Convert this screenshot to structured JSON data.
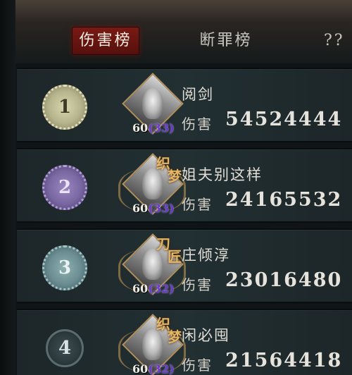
{
  "tabs": [
    {
      "label": "伤害榜",
      "active": true
    },
    {
      "label": "断罪榜",
      "active": false
    },
    {
      "label": "??",
      "active": false
    }
  ],
  "colors": {
    "active_tab": "#6b1612",
    "row_bg": "#223033",
    "level_sub": "#6a3ac8"
  },
  "rows": [
    {
      "rank": "1",
      "name": "阅剑",
      "level": "60",
      "level_sub": "(33)",
      "damage_label": "伤害",
      "damage": "54524444",
      "badge": [
        "",
        ""
      ]
    },
    {
      "rank": "2",
      "name": "姐夫别这样",
      "level": "60",
      "level_sub": "(33)",
      "damage_label": "伤害",
      "damage": "24165532",
      "badge": [
        "织",
        "梦"
      ]
    },
    {
      "rank": "3",
      "name": "庄倾淳",
      "level": "60",
      "level_sub": "(32)",
      "damage_label": "伤害",
      "damage": "23016480",
      "badge": [
        "刀",
        "匠"
      ]
    },
    {
      "rank": "4",
      "name": "闲必囤",
      "level": "60",
      "level_sub": "(32)",
      "damage_label": "伤害",
      "damage": "21564418",
      "badge": [
        "织",
        "梦"
      ]
    }
  ]
}
